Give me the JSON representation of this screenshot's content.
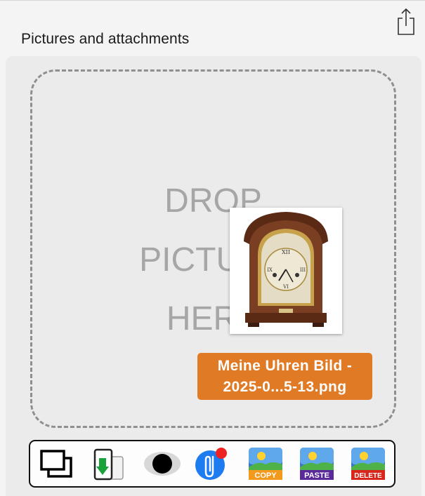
{
  "section": {
    "title": "Pictures and attachments"
  },
  "dropzone": {
    "lines": [
      "DROP",
      "PICTURE",
      "HERE"
    ]
  },
  "attachment": {
    "filename_line1": "Meine Uhren Bild -",
    "filename_line2": "2025-0...5-13.png"
  },
  "toolbar": {
    "copy_label": "COPY",
    "paste_label": "PASTE",
    "delete_label": "DELETE"
  },
  "icons": {
    "share": "share-icon",
    "photos": "photo-stack-icon",
    "import": "phone-import-icon",
    "view": "eye-icon",
    "attach": "paperclip-icon",
    "copy": "copy-picture-icon",
    "paste": "paste-picture-icon",
    "delete": "delete-picture-icon"
  },
  "colors": {
    "accent_orange": "#e07a24",
    "attach_blue": "#1c7cf0",
    "badge_red": "#ee2222",
    "copy_orange": "#f39a1c",
    "paste_purple": "#5a2a9a",
    "delete_red": "#d9261c"
  }
}
